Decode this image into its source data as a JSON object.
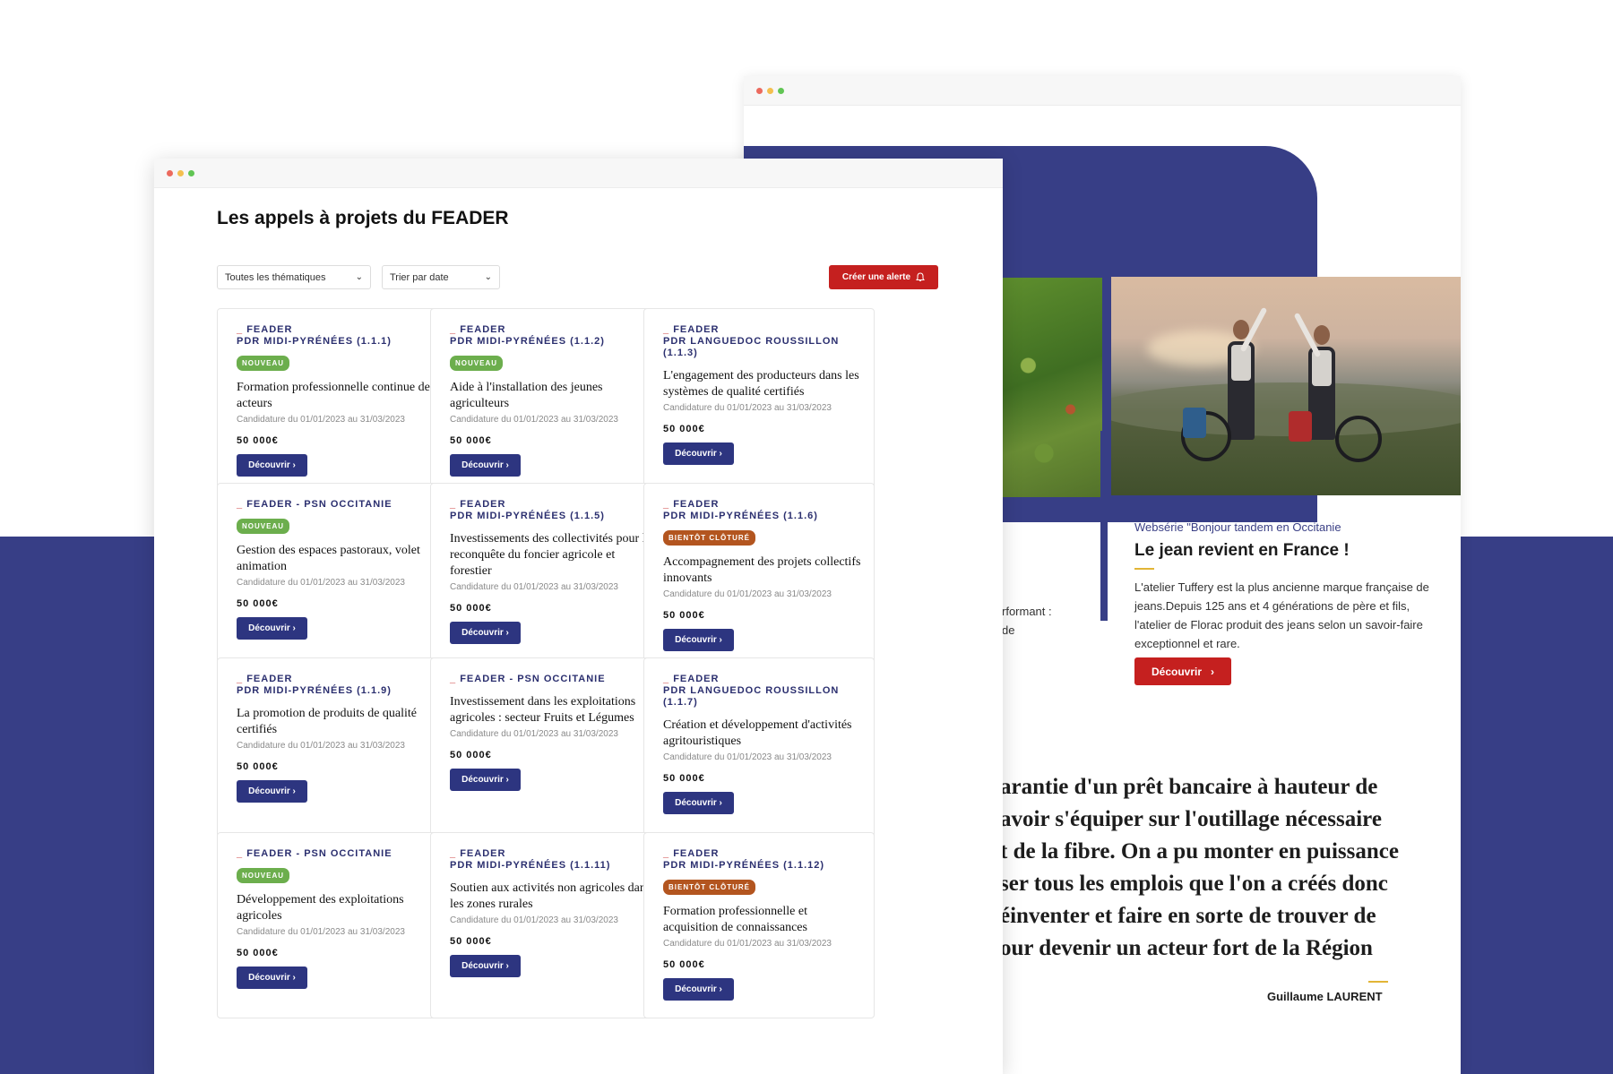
{
  "back_window": {
    "article": {
      "series": "Websérie \"Bonjour tandem en Occitanie",
      "title": "Le jean revient en France !",
      "text": "L'atelier Tuffery est la plus ancienne marque française de jeans.Depuis 125 ans et 4 générations de père et fils, l'atelier de Florac produit des jeans selon un savoir-faire exceptionnel et rare.",
      "button": "Découvrir"
    },
    "side_snippet": [
      "rformant :",
      "de"
    ],
    "quote_lines": [
      "arantie d'un prêt bancaire à hauteur de",
      "avoir s'équiper sur l'outillage nécessaire",
      "t de la fibre. On a pu monter en puissance",
      "ser tous les emplois que l'on a créés donc",
      "éinventer et faire en sorte de trouver de",
      "our devenir un acteur fort de la Région"
    ],
    "author": "Guillaume LAURENT"
  },
  "front_window": {
    "title": "Les appels à projets du FEADER",
    "filters": {
      "theme": "Toutes les thématiques",
      "sort": "Trier par date",
      "alert_button": "Créer une alerte"
    },
    "cards": [
      {
        "src": "FEADER\nPDR MIDI-PYRÉNÉES (1.1.1)",
        "badge": "NOUVEAU",
        "badge_type": "new",
        "title": "Formation professionnelle continue des acteurs",
        "dates": "Candidature du 01/01/2023 au 31/03/2023",
        "amount": "50 000€",
        "button": "Découvrir ›"
      },
      {
        "src": "FEADER\nPDR MIDI-PYRÉNÉES (1.1.2)",
        "badge": "NOUVEAU",
        "badge_type": "new",
        "title": "Aide à l'installation des jeunes agriculteurs",
        "dates": "Candidature du 01/01/2023 au 31/03/2023",
        "amount": "50 000€",
        "button": "Découvrir ›"
      },
      {
        "src": "FEADER\nPDR LANGUEDOC ROUSSILLON (1.1.3)",
        "badge": "",
        "badge_type": "",
        "title": "L'engagement des producteurs dans les systèmes de qualité certifiés",
        "dates": "Candidature du 01/01/2023 au 31/03/2023",
        "amount": "50 000€",
        "button": "Découvrir ›"
      },
      {
        "src": "FEADER - PSN OCCITANIE",
        "badge": "NOUVEAU",
        "badge_type": "new",
        "title": "Gestion des espaces pastoraux, volet animation",
        "dates": "Candidature du 01/01/2023 au 31/03/2023",
        "amount": "50 000€",
        "button": "Découvrir ›"
      },
      {
        "src": "FEADER\nPDR MIDI-PYRÉNÉES (1.1.5)",
        "badge": "",
        "badge_type": "",
        "title": "Investissements des collectivités pour la reconquête du foncier agricole et forestier",
        "dates": "Candidature du 01/01/2023 au 31/03/2023",
        "amount": "50 000€",
        "button": "Découvrir ›"
      },
      {
        "src": "FEADER\nPDR MIDI-PYRÉNÉES (1.1.6)",
        "badge": "BIENTÔT CLÔTURÉ",
        "badge_type": "soon",
        "title": "Accompagnement des projets collectifs innovants",
        "dates": "Candidature du 01/01/2023 au 31/03/2023",
        "amount": "50 000€",
        "button": "Découvrir ›"
      },
      {
        "src": "FEADER\nPDR MIDI-PYRÉNÉES (1.1.9)",
        "badge": "",
        "badge_type": "",
        "title": "La promotion de produits de qualité certifiés",
        "dates": "Candidature du 01/01/2023 au 31/03/2023",
        "amount": "50 000€",
        "button": "Découvrir ›"
      },
      {
        "src": "FEADER - PSN OCCITANIE",
        "badge": "",
        "badge_type": "",
        "title": "Investissement dans les exploitations agricoles : secteur Fruits et Légumes",
        "dates": "Candidature du 01/01/2023 au 31/03/2023",
        "amount": "50 000€",
        "button": "Découvrir ›"
      },
      {
        "src": "FEADER\nPDR LANGUEDOC ROUSSILLON (1.1.7)",
        "badge": "",
        "badge_type": "",
        "title": "Création et développement d'activités agritouristiques",
        "dates": "Candidature du 01/01/2023 au 31/03/2023",
        "amount": "50 000€",
        "button": "Découvrir ›"
      },
      {
        "src": "FEADER - PSN OCCITANIE",
        "badge": "NOUVEAU",
        "badge_type": "new",
        "title": "Développement des exploitations agricoles",
        "dates": "Candidature du 01/01/2023 au 31/03/2023",
        "amount": "50 000€",
        "button": "Découvrir ›"
      },
      {
        "src": "FEADER\nPDR MIDI-PYRÉNÉES (1.1.11)",
        "badge": "",
        "badge_type": "",
        "title": "Soutien aux activités non agricoles dans les zones rurales",
        "dates": "Candidature du 01/01/2023 au 31/03/2023",
        "amount": "50 000€",
        "button": "Découvrir ›"
      },
      {
        "src": "FEADER\nPDR MIDI-PYRÉNÉES (1.1.12)",
        "badge": "BIENTÔT CLÔTURÉ",
        "badge_type": "soon",
        "title": "Formation professionnelle et acquisition de connaissances",
        "dates": "Candidature du 01/01/2023 au 31/03/2023",
        "amount": "50 000€",
        "button": "Découvrir ›"
      }
    ]
  },
  "colors": {
    "navy": "#373e86",
    "button_navy": "#2d3580",
    "red": "#c5201f",
    "gold": "#e2b536",
    "badge_new": "#6cae4d",
    "badge_soon": "#b3551f"
  }
}
